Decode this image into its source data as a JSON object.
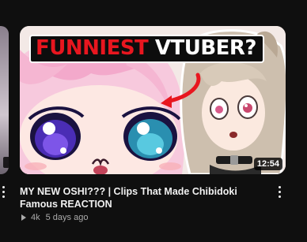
{
  "previous_video": {
    "menu_icon": "more-vert-icon"
  },
  "video": {
    "thumbnail_banner": {
      "red_text": "FUNNIEST",
      "white_text": " VTUBER?"
    },
    "duration": "12:54",
    "title": "MY NEW OSHI??? | Clips That Made Chibidoki Famous REACTION",
    "views": "4k",
    "age": "5 days ago",
    "views_icon": "play-icon",
    "menu_icon": "more-vert-icon"
  },
  "colors": {
    "background": "#0f0f0f",
    "banner_red": "#e8161f",
    "text_primary": "#f1f1f1",
    "text_secondary": "#aaaaaa"
  }
}
